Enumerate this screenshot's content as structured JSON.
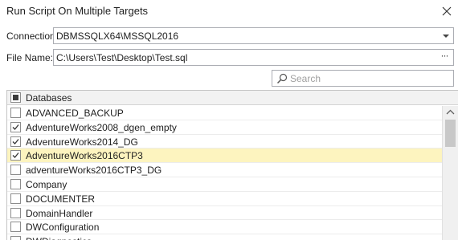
{
  "window": {
    "title": "Run Script On Multiple Targets"
  },
  "connection": {
    "label": "Connection:",
    "value": "DBMSSQLX64\\MSSQL2016"
  },
  "file": {
    "label": "File Name:",
    "value": "C:\\Users\\Test\\Desktop\\Test.sql",
    "browse": "···"
  },
  "search": {
    "placeholder": "Search"
  },
  "grid": {
    "header": "Databases",
    "rows": [
      {
        "name": "ADVANCED_BACKUP",
        "checked": false,
        "selected": false
      },
      {
        "name": "AdventureWorks2008_dgen_empty",
        "checked": true,
        "selected": false
      },
      {
        "name": "AdventureWorks2014_DG",
        "checked": true,
        "selected": false
      },
      {
        "name": "AdventureWorks2016CTP3",
        "checked": true,
        "selected": true
      },
      {
        "name": "adventureWorks2016CTP3_DG",
        "checked": false,
        "selected": false
      },
      {
        "name": "Company",
        "checked": false,
        "selected": false
      },
      {
        "name": "DOCUMENTER",
        "checked": false,
        "selected": false
      },
      {
        "name": "DomainHandler",
        "checked": false,
        "selected": false
      },
      {
        "name": "DWConfiguration",
        "checked": false,
        "selected": false
      },
      {
        "name": "DWDiagnostics",
        "checked": false,
        "selected": false
      }
    ]
  },
  "colors": {
    "selected_row": "#fdf4bf",
    "border": "#abadb3"
  },
  "icons": {
    "close": "close-icon",
    "combo": "chevron-down-icon",
    "search": "search-icon",
    "check": "checkmark-icon"
  }
}
